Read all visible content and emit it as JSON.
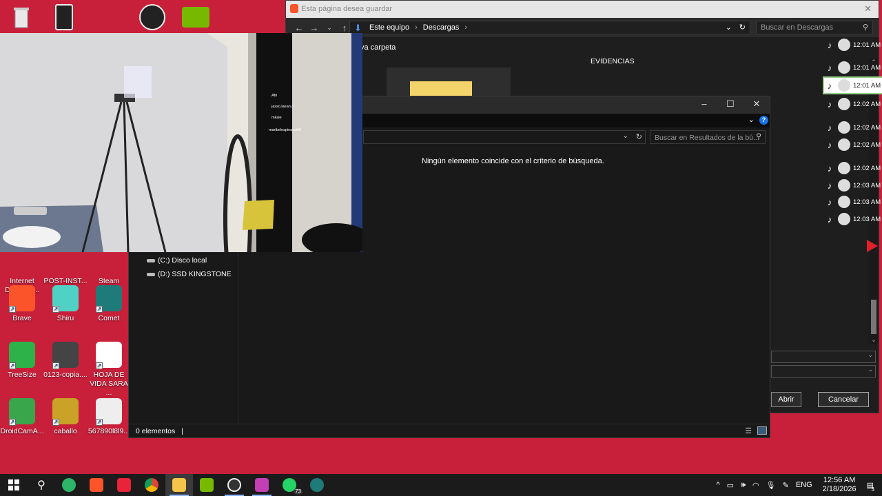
{
  "desktop": {
    "icons": [
      {
        "label": "Internet Downloa...",
        "icon": "idm-icon",
        "color": "#3a6ea5"
      },
      {
        "label": "POST-INST...",
        "icon": "video-file-icon",
        "color": "#444"
      },
      {
        "label": "Steam",
        "icon": "steam-icon",
        "color": "#1b2838"
      },
      {
        "label": "Brave",
        "icon": "brave-icon",
        "color": "#fb542b"
      },
      {
        "label": "Shiru",
        "icon": "shiru-icon",
        "color": "#4fd1c5"
      },
      {
        "label": "Comet",
        "icon": "comet-icon",
        "color": "#1f7a7a"
      },
      {
        "label": "TreeSize",
        "icon": "treesize-icon",
        "color": "#2db24a"
      },
      {
        "label": "0123-copia....",
        "icon": "video-file-icon",
        "color": "#444"
      },
      {
        "label": "HOJA DE VIDA SARA ...",
        "icon": "pdf-icon",
        "color": "#fff"
      },
      {
        "label": "DroidCamA...",
        "icon": "droidcam-icon",
        "color": "#3aa64c"
      },
      {
        "label": "caballo",
        "icon": "file-icon",
        "color": "#c9a227"
      },
      {
        "label": "567890l8l9...",
        "icon": "image-icon",
        "color": "#eee"
      }
    ]
  },
  "save_dialog": {
    "title": "Esta página desea guardar",
    "breadcrumb": [
      "Este equipo",
      "Descargas"
    ],
    "search_placeholder": "Buscar en Descargas",
    "new_folder_label": "va carpeta",
    "folder_label": "EVIDENCIAS",
    "open_button": "Abrir",
    "cancel_button": "Cancelar"
  },
  "tiktok_list": {
    "times": [
      "12:01 AM",
      "12:01 AM",
      "12:01 AM",
      "12:02 AM",
      "12:02 AM",
      "12:02 AM",
      "12:02 AM",
      "12:03 AM",
      "12:03 AM",
      "12:03 AM"
    ]
  },
  "explorer": {
    "search_placeholder": "Buscar en Resultados de la bú...",
    "empty_message": "Ningún elemento coincide con el criterio de búsqueda.",
    "drives": [
      "(C:) Disco local",
      "(D:) SSD KINGSTONE"
    ],
    "status": "0 elementos"
  },
  "webcam_chat": {
    "users": [
      "Afri",
      "jasso.laean.o",
      "mkaie",
      "maribelespinavalit6"
    ]
  },
  "taskbar": {
    "language": "ENG",
    "time": "12:56 AM",
    "date": "2/18/2026",
    "whatsapp_badge": "73",
    "notification_count": "3"
  }
}
